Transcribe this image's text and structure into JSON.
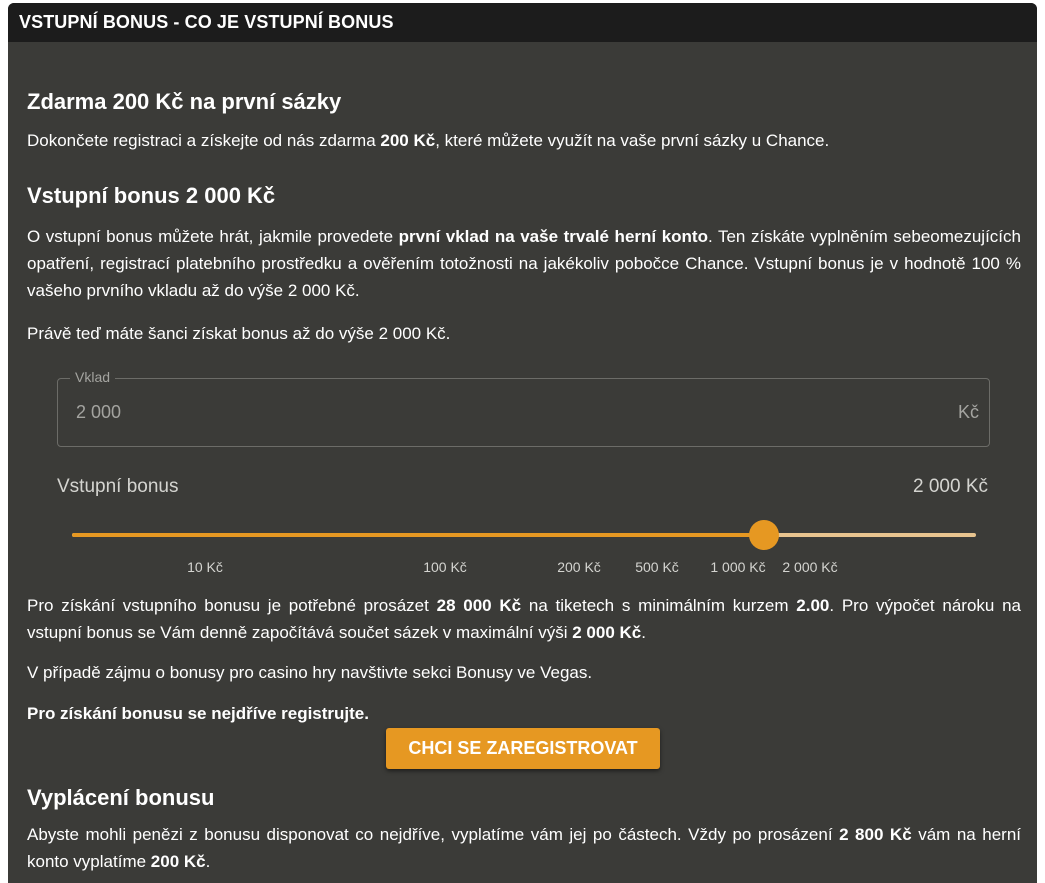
{
  "header": {
    "title": "VSTUPNÍ BONUS - CO JE VSTUPNÍ BONUS"
  },
  "section_free": {
    "heading": "Zdarma 200 Kč na první sázky",
    "text_before": "Dokončete registraci a získejte od nás zdarma ",
    "text_bold": "200 Kč",
    "text_after": ", které můžete využít na vaše první sázky u Chance."
  },
  "section_entry": {
    "heading": "Vstupní bonus 2 000 Kč",
    "text_before": "O vstupní bonus můžete hrát, jakmile provedete ",
    "text_bold": "první vklad na vaše trvalé herní konto",
    "text_after": ". Ten získáte vyplněním sebeomezujících opatření, registrací platebního prostředku a ověřením totožnosti na jakékoliv pobočce Chance. Vstupní bonus je v hodnotě 100 % vašeho prvního vkladu až do výše 2 000 Kč.",
    "chance_text": "Právě teď máte šanci získat bonus až do výše 2 000 Kč."
  },
  "calculator": {
    "deposit_label": "Vklad",
    "deposit_value": "2 000",
    "deposit_unit": "Kč",
    "bonus_label": "Vstupní bonus",
    "bonus_value": "2 000 Kč",
    "slider_level": 0.765,
    "ticks": [
      {
        "label": "10 Kč",
        "pos": 0.147
      },
      {
        "label": "100 Kč",
        "pos": 0.413
      },
      {
        "label": "200 Kč",
        "pos": 0.561
      },
      {
        "label": "500 Kč",
        "pos": 0.647
      },
      {
        "label": "1 000 Kč",
        "pos": 0.737
      },
      {
        "label": "2 000 Kč",
        "pos": 0.816
      }
    ]
  },
  "conditions": {
    "t1": "Pro získání vstupního bonusu je potřebné prosázet ",
    "b1": "28 000 Kč",
    "t2": " na tiketech s minimálním kurzem ",
    "b2": "2.00",
    "t3": ". Pro výpočet nároku na vstupní bonus se Vám denně započítává součet sázek v maximální výši ",
    "b3": "2 000 Kč",
    "t4": ".",
    "casino_text": "V případě zájmu o bonusy pro casino hry navštivte sekci Bonusy ve Vegas.",
    "register_note": "Pro získání bonusu se nejdříve registrujte.",
    "cta_label": "CHCI SE ZAREGISTROVAT"
  },
  "section_payout": {
    "heading": "Vyplácení bonusu",
    "t1": "Abyste mohli penězi z bonusu disponovat co nejdříve, vyplatíme vám jej po částech. Vždy po prosázení ",
    "b1": "2 800 Kč",
    "t2": " vám na herní konto vyplatíme ",
    "b2": "200 Kč",
    "t3": "."
  },
  "colors": {
    "panel_bg": "#3b3b38",
    "header_bg": "#1c1c1c",
    "accent": "#e69822",
    "accent_light": "#e8c48f"
  }
}
